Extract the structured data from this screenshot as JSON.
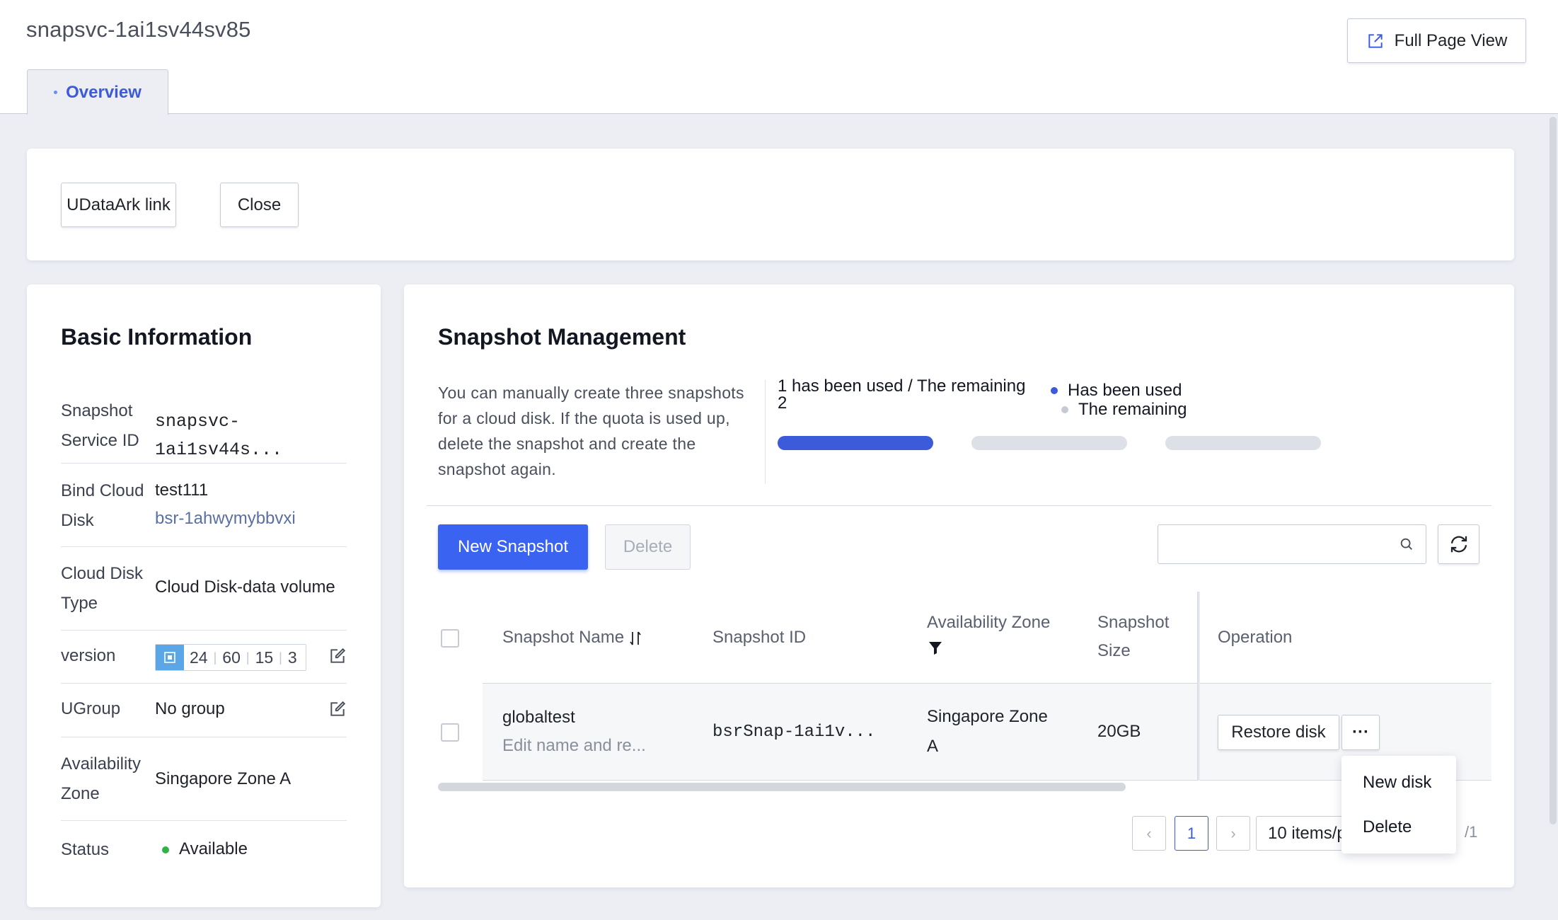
{
  "header": {
    "title": "snapsvc-1ai1sv44sv85",
    "full_page_view": "Full Page View",
    "tabs": [
      {
        "label": "Overview"
      }
    ]
  },
  "actions": {
    "udataark_link": "UDataArk link",
    "close": "Close"
  },
  "basic_info": {
    "title": "Basic Information",
    "rows": [
      {
        "label": "Snapshot Service ID",
        "value": "snapsvc-1ai1sv44s..."
      },
      {
        "label": "Bind Cloud Disk",
        "value": "test111",
        "sub_value": "bsr-1ahwymybbvxi"
      },
      {
        "label": "Cloud Disk Type",
        "value": "Cloud Disk-data volume"
      },
      {
        "label": "version",
        "version_parts": [
          "24",
          "60",
          "15",
          "3"
        ]
      },
      {
        "label": "UGroup",
        "value": "No group"
      },
      {
        "label": "Availability Zone",
        "value": "Singapore Zone A"
      },
      {
        "label": "Status",
        "value": "Available"
      }
    ]
  },
  "snapshot": {
    "title": "Snapshot Management",
    "description": "You can manually create three snapshots for a cloud disk. If the quota is used up, delete the snapshot and create the snapshot again.",
    "quota": {
      "text": "1 has been used / The remaining",
      "remaining_value": "2",
      "legend_used": "Has been used",
      "legend_remaining": "The remaining",
      "used": 1,
      "total": 3,
      "used_color": "#3b5bdb",
      "remaining_color": "#dde0e6"
    },
    "new_snapshot": "New Snapshot",
    "delete": "Delete",
    "search": {
      "placeholder": "",
      "value": ""
    },
    "table": {
      "headers": {
        "name": "Snapshot Name",
        "id": "Snapshot ID",
        "zone": "Availability Zone",
        "size": "Snapshot Size",
        "operation": "Operation"
      },
      "rows": [
        {
          "name": "globaltest",
          "name_sub": "Edit name and re...",
          "id": "bsrSnap-1ai1v...",
          "zone": "Singapore Zone A",
          "size": "20GB",
          "restore": "Restore disk",
          "more": "···"
        }
      ]
    },
    "pagination": {
      "prev": "‹",
      "current": "1",
      "next": "›",
      "page_size": "10 items/page",
      "total_pages": "/1"
    },
    "dropdown": {
      "items": [
        "New disk",
        "Delete"
      ]
    }
  },
  "colors": {
    "primary": "#3b63f1",
    "status_ok": "#2fb344"
  }
}
